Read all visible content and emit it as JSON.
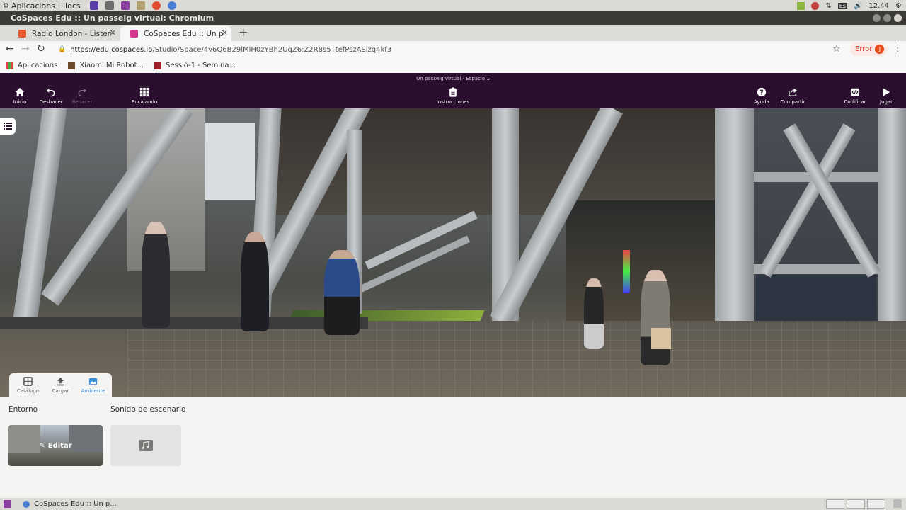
{
  "os_top": {
    "menu_apps": "Aplicacions",
    "menu_places": "Llocs",
    "keyboard_layout": "Es",
    "clock": "12.44"
  },
  "window": {
    "title": "CoSpaces Edu :: Un passeig virtual: Chromium"
  },
  "tabs": [
    {
      "label": "Radio London - Listen Live",
      "active": false
    },
    {
      "label": "CoSpaces Edu :: Un passeig virtual",
      "active": true
    }
  ],
  "address": {
    "scheme_host": "https://edu.cospaces.io",
    "path": "/Studio/Space/4v6Q6B29lMlH0zYBh2UqZ6:Z2R8s5TtefPszASizq4kf3",
    "error_label": "Error",
    "error_count": "J"
  },
  "bookmarks": [
    {
      "label": "Aplicacions"
    },
    {
      "label": "Xiaomi Mi Robot..."
    },
    {
      "label": "Sessió-1 - Semina..."
    }
  ],
  "app": {
    "space_title": "Un passeig virtual - Espacio 1",
    "toolbar": {
      "home": "Inicio",
      "undo": "Deshacer",
      "redo": "Rehacer",
      "snapping": "Encajando",
      "instructions": "Instrucciones",
      "help": "Ayuda",
      "share": "Compartir",
      "code": "Codificar",
      "play": "Jugar"
    }
  },
  "bottom_tabs": {
    "catalog": "Catálogo",
    "upload": "Cargar",
    "environment": "Ambiente"
  },
  "environment_panel": {
    "env_title": "Entorno",
    "sound_title": "Sonido de escenario",
    "edit_label": "Editar"
  },
  "taskbar": {
    "window_label": "CoSpaces Edu :: Un p..."
  },
  "colors": {
    "header_bg": "#2a0f2e",
    "accent": "#3b8fdc",
    "error": "#d93025"
  }
}
